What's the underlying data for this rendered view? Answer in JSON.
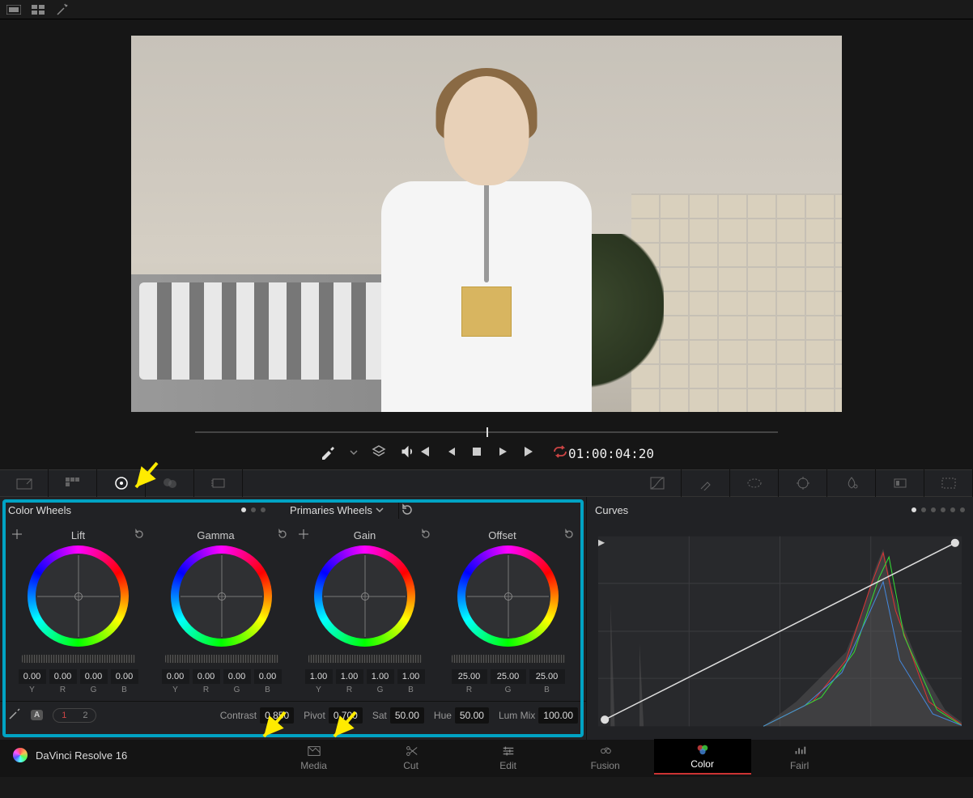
{
  "timecode": "01:00:04:20",
  "brand": "DaVinci Resolve 16",
  "panels": {
    "colorWheels": {
      "title": "Color Wheels",
      "primaries": "Primaries Wheels",
      "wheels": [
        {
          "name": "Lift",
          "ch": [
            "Y",
            "R",
            "G",
            "B"
          ],
          "vals": [
            "0.00",
            "0.00",
            "0.00",
            "0.00"
          ]
        },
        {
          "name": "Gamma",
          "ch": [
            "Y",
            "R",
            "G",
            "B"
          ],
          "vals": [
            "0.00",
            "0.00",
            "0.00",
            "0.00"
          ]
        },
        {
          "name": "Gain",
          "ch": [
            "Y",
            "R",
            "G",
            "B"
          ],
          "vals": [
            "1.00",
            "1.00",
            "1.00",
            "1.00"
          ]
        },
        {
          "name": "Offset",
          "ch": [
            "R",
            "G",
            "B"
          ],
          "vals": [
            "25.00",
            "25.00",
            "25.00"
          ]
        }
      ],
      "globals": {
        "contrast": {
          "label": "Contrast",
          "value": "0.850"
        },
        "pivot": {
          "label": "Pivot",
          "value": "0.700"
        },
        "sat": {
          "label": "Sat",
          "value": "50.00"
        },
        "hue": {
          "label": "Hue",
          "value": "50.00"
        },
        "lummix": {
          "label": "Lum Mix",
          "value": "100.00"
        }
      },
      "pages": [
        "1",
        "2"
      ]
    },
    "curves": {
      "title": "Curves"
    }
  },
  "pageTabs": [
    {
      "id": "media",
      "label": "Media"
    },
    {
      "id": "cut",
      "label": "Cut"
    },
    {
      "id": "edit",
      "label": "Edit"
    },
    {
      "id": "fusion",
      "label": "Fusion"
    },
    {
      "id": "color",
      "label": "Color",
      "active": true
    },
    {
      "id": "fairlight",
      "label": "Fairl"
    }
  ]
}
